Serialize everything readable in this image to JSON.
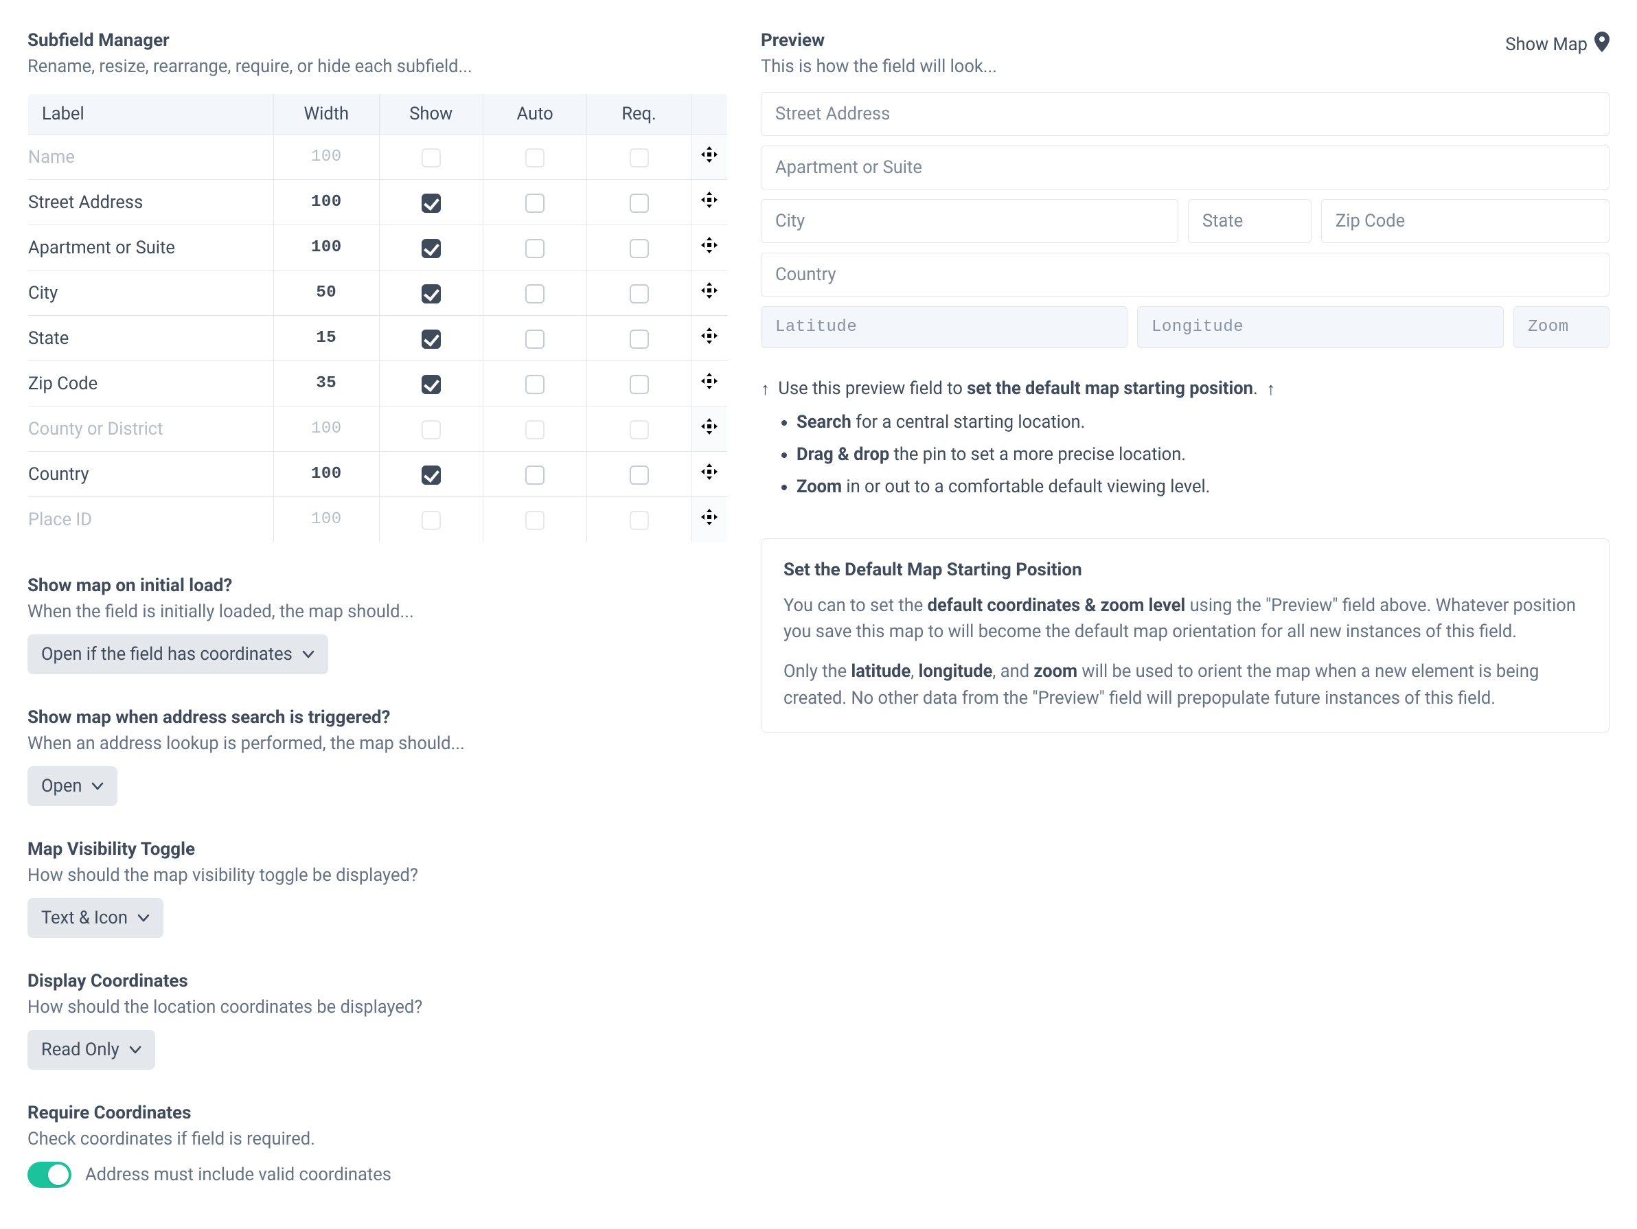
{
  "left": {
    "title": "Subfield Manager",
    "subtitle": "Rename, resize, rearrange, require, or hide each subfield...",
    "columns": {
      "label": "Label",
      "width": "Width",
      "show": "Show",
      "auto": "Auto",
      "req": "Req."
    },
    "rows": [
      {
        "label": "Name",
        "width": "100",
        "show": false,
        "auto": false,
        "req": false,
        "enabled": false
      },
      {
        "label": "Street Address",
        "width": "100",
        "show": true,
        "auto": false,
        "req": false,
        "enabled": true
      },
      {
        "label": "Apartment or Suite",
        "width": "100",
        "show": true,
        "auto": false,
        "req": false,
        "enabled": true
      },
      {
        "label": "City",
        "width": "50",
        "show": true,
        "auto": false,
        "req": false,
        "enabled": true
      },
      {
        "label": "State",
        "width": "15",
        "show": true,
        "auto": false,
        "req": false,
        "enabled": true
      },
      {
        "label": "Zip Code",
        "width": "35",
        "show": true,
        "auto": false,
        "req": false,
        "enabled": true
      },
      {
        "label": "County or District",
        "width": "100",
        "show": false,
        "auto": false,
        "req": false,
        "enabled": false
      },
      {
        "label": "Country",
        "width": "100",
        "show": true,
        "auto": false,
        "req": false,
        "enabled": true
      },
      {
        "label": "Place ID",
        "width": "100",
        "show": false,
        "auto": false,
        "req": false,
        "enabled": false
      }
    ],
    "settings": {
      "initialLoad": {
        "title": "Show map on initial load?",
        "hint": "When the field is initially loaded, the map should...",
        "value": "Open if the field has coordinates"
      },
      "searchTrigger": {
        "title": "Show map when address search is triggered?",
        "hint": "When an address lookup is performed, the map should...",
        "value": "Open"
      },
      "visToggle": {
        "title": "Map Visibility Toggle",
        "hint": "How should the map visibility toggle be displayed?",
        "value": "Text & Icon"
      },
      "coords": {
        "title": "Display Coordinates",
        "hint": "How should the location coordinates be displayed?",
        "value": "Read Only"
      },
      "reqCoords": {
        "title": "Require Coordinates",
        "hint": "Check coordinates if field is required.",
        "toggleLabel": "Address must include valid coordinates",
        "toggleOn": true
      }
    }
  },
  "right": {
    "previewTitle": "Preview",
    "previewSubtitle": "This is how the field will look...",
    "showMap": "Show Map",
    "placeholders": {
      "street": "Street Address",
      "apt": "Apartment or Suite",
      "city": "City",
      "state": "State",
      "zip": "Zip Code",
      "country": "Country",
      "lat": "Latitude",
      "lng": "Longitude",
      "zoom": "Zoom"
    },
    "instr": {
      "prefix": "Use this preview field to ",
      "strong": "set the default map starting position",
      "suffix": ".",
      "b1_strong": "Search",
      "b1_rest": " for a central starting location.",
      "b2_strong": "Drag & drop",
      "b2_rest": " the pin to set a more precise location.",
      "b3_strong": "Zoom",
      "b3_rest": " in or out to a comfortable default viewing level."
    },
    "info": {
      "title": "Set the Default Map Starting Position",
      "p1a": "You can to set the ",
      "p1b": "default coordinates & zoom level",
      "p1c": " using the \"Preview\" field above. Whatever position you save this map to will become the default map orientation for all new instances of this field.",
      "p2a": "Only the ",
      "p2_lat": "latitude",
      "p2_s1": ", ",
      "p2_lng": "longitude",
      "p2_s2": ", and ",
      "p2_zoom": "zoom",
      "p2b": " will be used to orient the map when a new element is being created. No other data from the \"Preview\" field will prepopulate future instances of this field."
    }
  }
}
